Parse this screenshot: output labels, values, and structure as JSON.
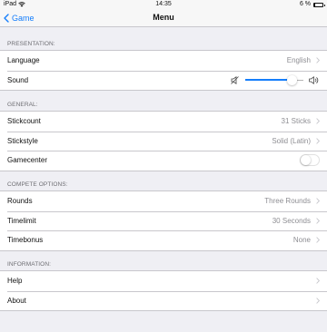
{
  "status_bar": {
    "carrier": "iPad",
    "time": "14:35",
    "battery_text": "6 %",
    "battery_level": 0.06,
    "icons": [
      "wifi-icon",
      "battery-icon"
    ]
  },
  "nav": {
    "back_label": "Game",
    "title": "Menu"
  },
  "sections": {
    "presentation": {
      "header": "PRESENTATION:",
      "language": {
        "label": "Language",
        "value": "English"
      },
      "sound": {
        "label": "Sound",
        "level": 0.8
      }
    },
    "general": {
      "header": "GENERAL:",
      "stickcount": {
        "label": "Stickcount",
        "value": "31 Sticks"
      },
      "stickstyle": {
        "label": "Stickstyle",
        "value": "Solid (Latin)"
      },
      "gamecenter": {
        "label": "Gamecenter",
        "enabled": false
      }
    },
    "compete": {
      "header": "COMPETE OPTIONS:",
      "rounds": {
        "label": "Rounds",
        "value": "Three Rounds"
      },
      "timelimit": {
        "label": "Timelimit",
        "value": "30 Seconds"
      },
      "timebonus": {
        "label": "Timebonus",
        "value": "None"
      }
    },
    "information": {
      "header": "INFORMATION:",
      "help": {
        "label": "Help"
      },
      "about": {
        "label": "About"
      }
    }
  },
  "colors": {
    "accent": "#157efb",
    "background": "#efeff4",
    "secondary_text": "#8e8e93",
    "separator": "#c8c7cc"
  }
}
